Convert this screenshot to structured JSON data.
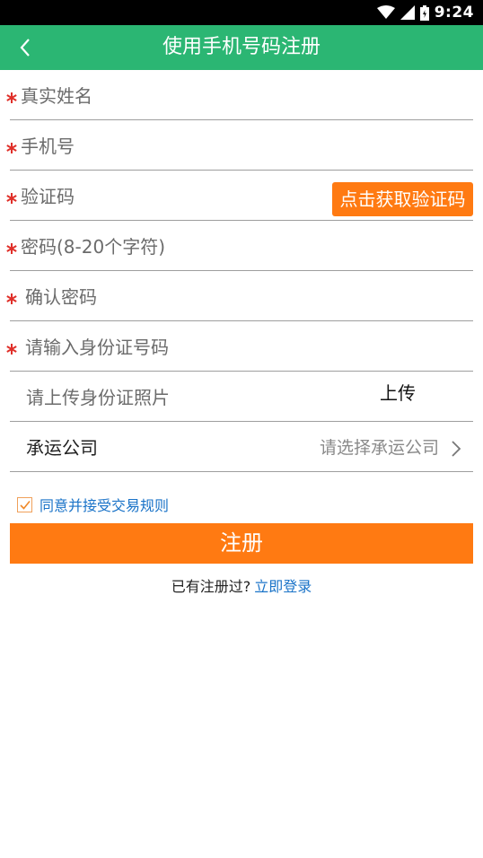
{
  "status": {
    "time": "9:24",
    "wifi_icon": "wifi-icon",
    "signal_icon": "signal-icon",
    "battery_icon": "battery-icon"
  },
  "header": {
    "title": "使用手机号码注册",
    "back_icon": "chevron-left-icon"
  },
  "form": {
    "name_placeholder": "真实姓名",
    "phone_placeholder": "手机号",
    "code_placeholder": "验证码",
    "code_button": "点击获取验证码",
    "password_placeholder": "密码(8-20个字符)",
    "confirm_placeholder": "确认密码",
    "idnum_placeholder": "请输入身份证号码",
    "idphoto_label": "请上传身份证照片",
    "upload_label": "上传",
    "company_label": "承运公司",
    "company_value": "请选择承运公司"
  },
  "agreement": {
    "checked": true,
    "text": "同意并接受交易规则"
  },
  "submit_label": "注册",
  "login": {
    "prompt": "已有注册过?",
    "link": "立即登录"
  },
  "colors": {
    "appbar": "#2bb673",
    "accent": "#ff7a12",
    "link": "#1a73c8",
    "required": "#e0302a"
  }
}
